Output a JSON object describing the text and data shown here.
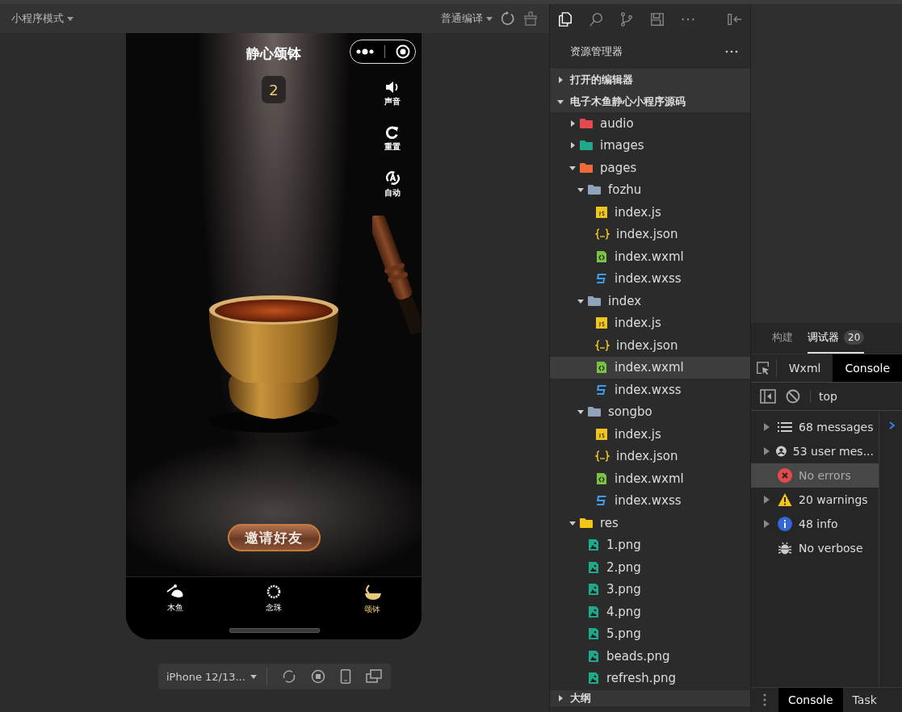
{
  "simulator_toolbar": {
    "mode": "小程序模式",
    "compile": "普通编译"
  },
  "phone": {
    "title": "静心颂钵",
    "counter": "2",
    "side_buttons": [
      {
        "kind": "sound",
        "label": "声音"
      },
      {
        "kind": "reset",
        "label": "重置"
      },
      {
        "kind": "auto",
        "label": "自动"
      }
    ],
    "invite_button": "邀请好友",
    "tabs": [
      {
        "kind": "fish",
        "label": "木鱼",
        "selected": false
      },
      {
        "kind": "beads",
        "label": "念珠",
        "selected": false
      },
      {
        "kind": "bowl",
        "label": "颂钵",
        "selected": true
      }
    ]
  },
  "device_bar": {
    "device": "iPhone 12/13..."
  },
  "explorer": {
    "title": "资源管理器",
    "sections": [
      {
        "label": "打开的编辑器",
        "expanded": false
      },
      {
        "label": "电子木鱼静心小程序源码",
        "expanded": true,
        "children": [
          {
            "name": "audio",
            "kind": "folder",
            "color": "#e5484d",
            "expanded": false,
            "selected": false
          },
          {
            "name": "images",
            "kind": "folder",
            "color": "#1fa88a",
            "expanded": false,
            "selected": false
          },
          {
            "name": "pages",
            "kind": "folder",
            "color": "#f06a3c",
            "expanded": true,
            "selected": false,
            "children": [
              {
                "name": "fozhu",
                "kind": "folder",
                "color": "#90a4b8",
                "expanded": true,
                "selected": false,
                "children": [
                  {
                    "name": "index.js",
                    "kind": "js",
                    "selected": false
                  },
                  {
                    "name": "index.json",
                    "kind": "json",
                    "selected": false
                  },
                  {
                    "name": "index.wxml",
                    "kind": "wxml",
                    "selected": false
                  },
                  {
                    "name": "index.wxss",
                    "kind": "wxss",
                    "selected": false
                  }
                ]
              },
              {
                "name": "index",
                "kind": "folder",
                "color": "#90a4b8",
                "expanded": true,
                "selected": false,
                "children": [
                  {
                    "name": "index.js",
                    "kind": "js",
                    "selected": false
                  },
                  {
                    "name": "index.json",
                    "kind": "json",
                    "selected": false
                  },
                  {
                    "name": "index.wxml",
                    "kind": "wxml",
                    "selected": true
                  },
                  {
                    "name": "index.wxss",
                    "kind": "wxss",
                    "selected": false
                  }
                ]
              },
              {
                "name": "songbo",
                "kind": "folder",
                "color": "#90a4b8",
                "expanded": true,
                "selected": false,
                "children": [
                  {
                    "name": "index.js",
                    "kind": "js",
                    "selected": false
                  },
                  {
                    "name": "index.json",
                    "kind": "json",
                    "selected": false
                  },
                  {
                    "name": "index.wxml",
                    "kind": "wxml",
                    "selected": false
                  },
                  {
                    "name": "index.wxss",
                    "kind": "wxss",
                    "selected": false
                  }
                ]
              }
            ]
          },
          {
            "name": "res",
            "kind": "folder",
            "color": "#f5c518",
            "expanded": true,
            "selected": false,
            "children": [
              {
                "name": "1.png",
                "kind": "png",
                "selected": false
              },
              {
                "name": "2.png",
                "kind": "png",
                "selected": false
              },
              {
                "name": "3.png",
                "kind": "png",
                "selected": false
              },
              {
                "name": "4.png",
                "kind": "png",
                "selected": false
              },
              {
                "name": "5.png",
                "kind": "png",
                "selected": false
              },
              {
                "name": "beads.png",
                "kind": "png",
                "selected": false
              },
              {
                "name": "refresh.png",
                "kind": "png",
                "selected": false
              }
            ]
          }
        ]
      },
      {
        "label": "大纲",
        "expanded": false
      }
    ]
  },
  "debugger": {
    "tabs": [
      {
        "label": "构建",
        "selected": false
      },
      {
        "label": "调试器",
        "badge": "20",
        "selected": true
      }
    ],
    "panel_tabs": [
      {
        "label": "Wxml",
        "selected": false
      },
      {
        "label": "Console",
        "selected": true
      }
    ],
    "context": "top",
    "filters": [
      {
        "kind": "messages",
        "label": "68 messages",
        "expandable": true,
        "selected": false
      },
      {
        "kind": "user",
        "label": "53 user mes...",
        "expandable": true,
        "selected": false
      },
      {
        "kind": "errors",
        "label": "No errors",
        "expandable": false,
        "selected": true
      },
      {
        "kind": "warnings",
        "label": "20 warnings",
        "expandable": true,
        "selected": false
      },
      {
        "kind": "info",
        "label": "48 info",
        "expandable": true,
        "selected": false
      },
      {
        "kind": "verbose",
        "label": "No verbose",
        "expandable": false,
        "selected": false
      }
    ],
    "drawer_tabs": [
      {
        "label": "Console",
        "selected": true
      },
      {
        "label": "Task",
        "selected": false
      }
    ]
  }
}
